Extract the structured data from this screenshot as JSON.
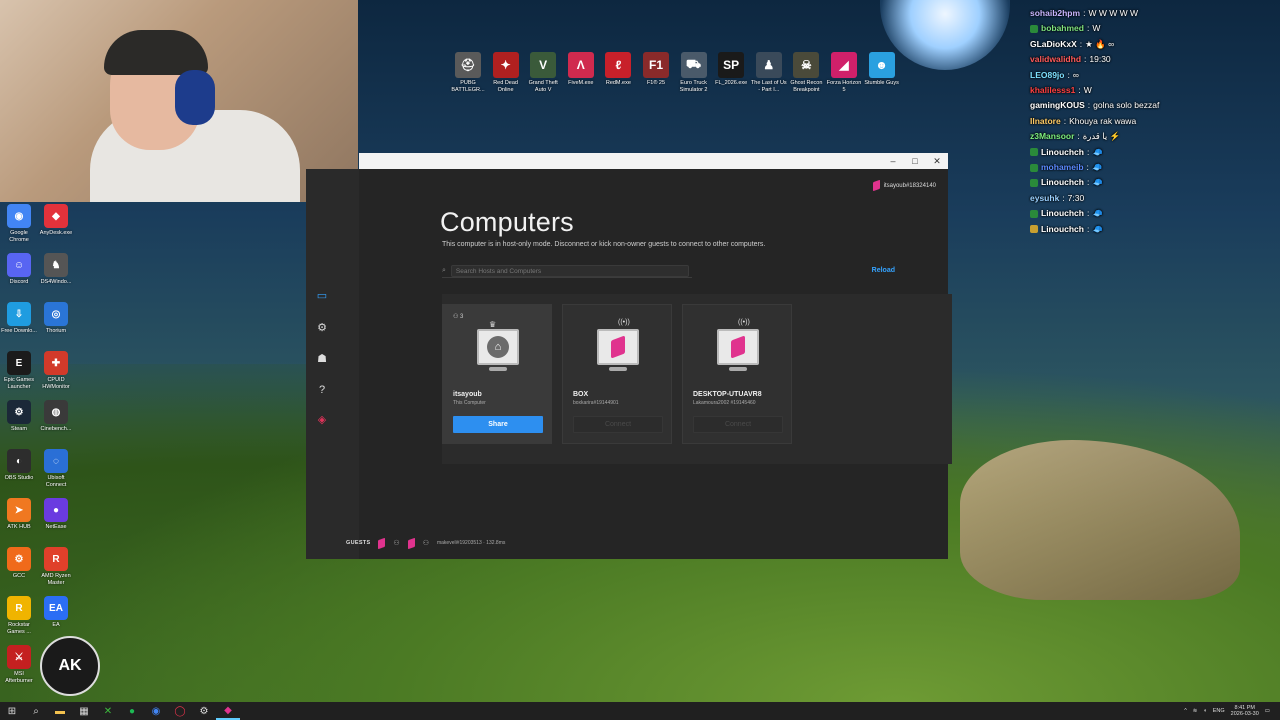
{
  "desktop": {
    "left_icons": [
      {
        "label": "Google Chrome",
        "icon": "chrome-icon",
        "color": "#4285f4",
        "glyph": "◉"
      },
      {
        "label": "AnyDesk.exe",
        "icon": "anydesk-icon",
        "color": "#e3323b",
        "glyph": "◆"
      },
      {
        "label": "Discord",
        "icon": "discord-icon",
        "color": "#5865f2",
        "glyph": "☺"
      },
      {
        "label": "DS4Windo...",
        "icon": "ds4windows-icon",
        "color": "#555555",
        "glyph": "♞"
      },
      {
        "label": "Free Downlo...",
        "icon": "free-download-manager-icon",
        "color": "#1f9ce0",
        "glyph": "⇩"
      },
      {
        "label": "Thorium",
        "icon": "thorium-icon",
        "color": "#2a75d6",
        "glyph": "◎"
      },
      {
        "label": "Epic Games Launcher",
        "icon": "epic-games-icon",
        "color": "#1b1b1b",
        "glyph": "E"
      },
      {
        "label": "CPUID HWMonitor",
        "icon": "hwmonitor-icon",
        "color": "#d23a2a",
        "glyph": "✚"
      },
      {
        "label": "Steam",
        "icon": "steam-icon",
        "color": "#1b2838",
        "glyph": "⚙"
      },
      {
        "label": "Cinebench...",
        "icon": "cinebench-icon",
        "color": "#3a3a3a",
        "glyph": "◍"
      },
      {
        "label": "OBS Studio",
        "icon": "obs-icon",
        "color": "#2d2d2d",
        "glyph": "◐"
      },
      {
        "label": "Ubisoft Connect",
        "icon": "ubisoft-icon",
        "color": "#2a6fd6",
        "glyph": "◌"
      },
      {
        "label": "ATK HUB",
        "icon": "atk-hub-icon",
        "color": "#f07820",
        "glyph": "➤"
      },
      {
        "label": "NetEase",
        "icon": "netease-icon",
        "color": "#6a3be0",
        "glyph": "●"
      },
      {
        "label": "GCC",
        "icon": "gcc-icon",
        "color": "#f06a1a",
        "glyph": "⚙"
      },
      {
        "label": "AMD Ryzen Master",
        "icon": "ryzen-master-icon",
        "color": "#e0402a",
        "glyph": "R"
      },
      {
        "label": "Rockstar Games ...",
        "icon": "rockstar-icon",
        "color": "#f0b400",
        "glyph": "R"
      },
      {
        "label": "EA",
        "icon": "ea-icon",
        "color": "#2b6ef5",
        "glyph": "EA"
      },
      {
        "label": "MSI Afterburner",
        "icon": "afterburner-icon",
        "color": "#c42020",
        "glyph": "⚔"
      }
    ],
    "ak_logo": "AK",
    "top_icons": [
      {
        "label": "PUBG BATTLEGR...",
        "icon": "pubg-icon",
        "color": "#5a5a5a",
        "glyph": "⛑"
      },
      {
        "label": "Red Dead Online",
        "icon": "red-dead-icon",
        "color": "#b02020",
        "glyph": "✦"
      },
      {
        "label": "Grand Theft Auto V",
        "icon": "gta-v-icon",
        "color": "#3a5a3a",
        "glyph": "V"
      },
      {
        "label": "FiveM.exe",
        "icon": "fivem-icon",
        "color": "#d02a4e",
        "glyph": "Λ"
      },
      {
        "label": "RedM.exe",
        "icon": "redm-icon",
        "color": "#c8202a",
        "glyph": "ℓ"
      },
      {
        "label": "F1® 25",
        "icon": "f1-25-icon",
        "color": "#8a2a2a",
        "glyph": "F1"
      },
      {
        "label": "Euro Truck Simulator 2",
        "icon": "ets2-icon",
        "color": "#4a5a6a",
        "glyph": "⛟"
      },
      {
        "label": "FL_2026.exe",
        "icon": "fl-2026-icon",
        "color": "#1a1a1a",
        "glyph": "SP"
      },
      {
        "label": "The Last of Us - Part I...",
        "icon": "tlou-icon",
        "color": "#3a4a5a",
        "glyph": "♟"
      },
      {
        "label": "Ghost Recon Breakpoint",
        "icon": "ghost-recon-icon",
        "color": "#4a4a3a",
        "glyph": "☠"
      },
      {
        "label": "Forza Horizon 5",
        "icon": "forza-icon",
        "color": "#d0206a",
        "glyph": "◢"
      },
      {
        "label": "Stumble Guys",
        "icon": "stumble-guys-icon",
        "color": "#2aa0e0",
        "glyph": "☻"
      }
    ]
  },
  "chat": [
    {
      "user": "sohaib2hpm",
      "msg": "W W W W W",
      "color": "#c9b6ff",
      "badge": ""
    },
    {
      "user": "bobahmed",
      "msg": "W",
      "color": "#7ee07e",
      "badge": "#2a8a3a"
    },
    {
      "user": "GLaDioKxX",
      "msg": "★ 🔥 ∞",
      "color": "#ffffff",
      "badge": ""
    },
    {
      "user": "validwalidhd",
      "msg": "19:30",
      "color": "#ff5a5a",
      "badge": ""
    },
    {
      "user": "LEO89jo",
      "msg": "∞",
      "color": "#7ee0ff",
      "badge": ""
    },
    {
      "user": "khalilesss1",
      "msg": "W",
      "color": "#ff4040",
      "badge": ""
    },
    {
      "user": "gamingKOUS",
      "msg": "golna solo bezzaf",
      "color": "#ffffff",
      "badge": ""
    },
    {
      "user": "Ilnatore",
      "msg": "Khouya rak wawa",
      "color": "#ffcc66",
      "badge": ""
    },
    {
      "user": "z3Mansoor",
      "msg": "يا قدرة ⚡",
      "color": "#7ef07e",
      "badge": ""
    },
    {
      "user": "Linouchch",
      "msg": "🧢",
      "color": "#ffffff",
      "badge": "#2a8a3a"
    },
    {
      "user": "mohameib",
      "msg": "🧢",
      "color": "#5a8aff",
      "badge": "#2a8a3a"
    },
    {
      "user": "Linouchch",
      "msg": "🧢",
      "color": "#ffffff",
      "badge": "#2a8a3a"
    },
    {
      "user": "eysuhk",
      "msg": "7:30",
      "color": "#9ad0ff",
      "badge": ""
    },
    {
      "user": "Linouchch",
      "msg": "🧢",
      "color": "#ffffff",
      "badge": "#2a8a3a"
    },
    {
      "user": "Linouchch",
      "msg": "🧢",
      "color": "#ffffff",
      "badge": "#c8a030"
    }
  ],
  "app": {
    "user_chip": "itsayoub#18324140",
    "title": "Computers",
    "subtitle": "This computer is in host-only mode. Disconnect or kick non-owner guests to connect to other computers.",
    "search_placeholder": "Search Hosts and Computers",
    "reload_label": "Reload",
    "sidebar": [
      "computers-icon",
      "settings-icon",
      "friends-icon",
      "help-icon",
      "parsec-logo-icon"
    ],
    "cards": [
      {
        "name": "itsayoub",
        "meta": "This Computer",
        "guests": "3",
        "button": "Share",
        "kind": "host"
      },
      {
        "name": "BOX",
        "meta": "boxkarira#19144901",
        "guests": "",
        "button": "Connect",
        "kind": "remote"
      },
      {
        "name": "DESKTOP-UTUAVR8",
        "meta": "Lakamoura2002 #19145460",
        "guests": "",
        "button": "Connect",
        "kind": "remote"
      }
    ],
    "guests_label": "GUESTS",
    "guest_meta": "makeveli#19203513 · 132.8ms",
    "window_controls": [
      "–",
      "□",
      "✕"
    ]
  },
  "taskbar": {
    "items": [
      "start-icon",
      "search-icon",
      "file-explorer-icon",
      "calculator-icon",
      "xbox-icon",
      "spotify-icon",
      "chrome-icon",
      "opera-icon",
      "steam-icon",
      "parsec-icon"
    ],
    "lang": "ENG",
    "time": "8:41 PM",
    "date": "2026-03-30"
  },
  "colors": {
    "accent": "#2d8ff0",
    "parsec_pink": "#e0338e",
    "link": "#35a3ff"
  }
}
